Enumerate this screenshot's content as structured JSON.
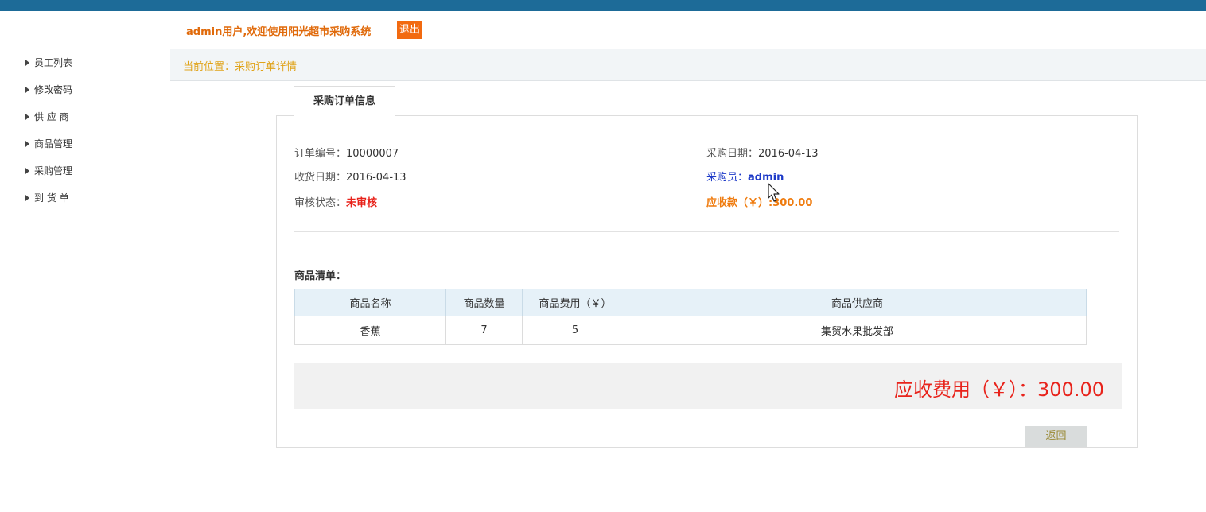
{
  "header": {
    "welcome": "admin用户,欢迎使用阳光超市采购系统",
    "logout_label": "退出"
  },
  "sidebar": {
    "items": [
      {
        "label": "员工列表"
      },
      {
        "label": "修改密码"
      },
      {
        "label": "供 应 商"
      },
      {
        "label": "商品管理"
      },
      {
        "label": "采购管理"
      },
      {
        "label": "到 货 单"
      }
    ]
  },
  "breadcrumb": "当前位置：采购订单详情",
  "tab": {
    "label": "采购订单信息"
  },
  "order": {
    "number_label": "订单编号：",
    "number_value": "10000007",
    "purchase_date_label": "采购日期：",
    "purchase_date_value": "2016-04-13",
    "receive_date_label": "收货日期：",
    "receive_date_value": "2016-04-13",
    "buyer_label": "采购员：",
    "buyer_value": "admin",
    "status_label": "审核状态：",
    "status_value": "未审核",
    "receivable_label": "应收款（￥）:",
    "receivable_value": "300.00"
  },
  "goods": {
    "title": "商品清单：",
    "columns": [
      "商品名称",
      "商品数量",
      "商品费用（￥）",
      "商品供应商"
    ],
    "rows": [
      [
        "香蕉",
        "7",
        "5",
        "集贸水果批发部"
      ]
    ]
  },
  "total": {
    "label": "应收费用（￥）：",
    "value": "300.00"
  },
  "back_label": "返回",
  "colors": {
    "topbar": "#1d6b98",
    "accent_orange": "#f26a10",
    "status_red": "#e8231b",
    "link_blue": "#1c39c8",
    "breadcrumb_gold": "#e0a31a"
  }
}
